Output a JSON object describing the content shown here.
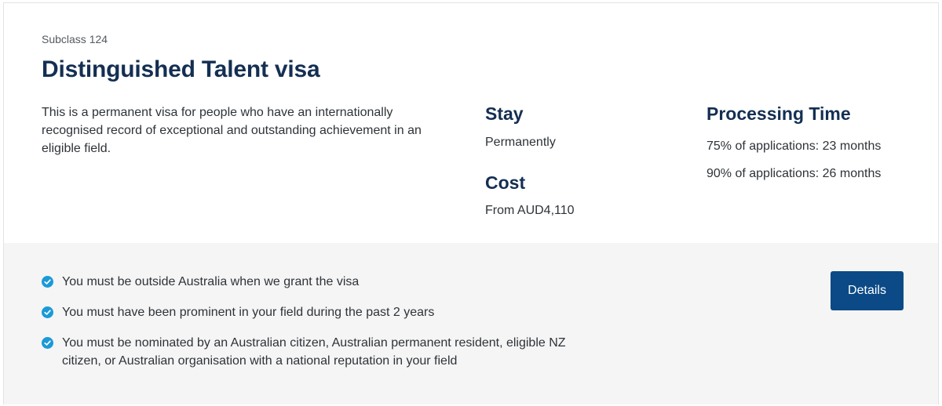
{
  "visa": {
    "subclass": "Subclass 124",
    "title": "Distinguished Talent visa",
    "description": "This is a permanent visa for people who have an internationally recognised record of exceptional and outstanding achievement in an eligible field."
  },
  "stay": {
    "heading": "Stay",
    "value": "Permanently"
  },
  "cost": {
    "heading": "Cost",
    "value": "From AUD4,110"
  },
  "processing": {
    "heading": "Processing Time",
    "items": [
      "75% of applications: 23 months",
      "90% of applications: 26 months"
    ]
  },
  "requirements": [
    "You must be outside Australia when we grant the visa",
    "You must have been prominent in your field during the past 2 years",
    "You must be nominated by an Australian citizen, Australian permanent resident, eligible NZ citizen, or Australian organisation with a national reputation in your field"
  ],
  "details_button": {
    "label": "Details"
  },
  "icons": {
    "check": "check-circle-icon"
  },
  "colors": {
    "heading": "#142f52",
    "button": "#0b4a86",
    "check": "#1b9ad6",
    "panel": "#f5f5f5"
  }
}
